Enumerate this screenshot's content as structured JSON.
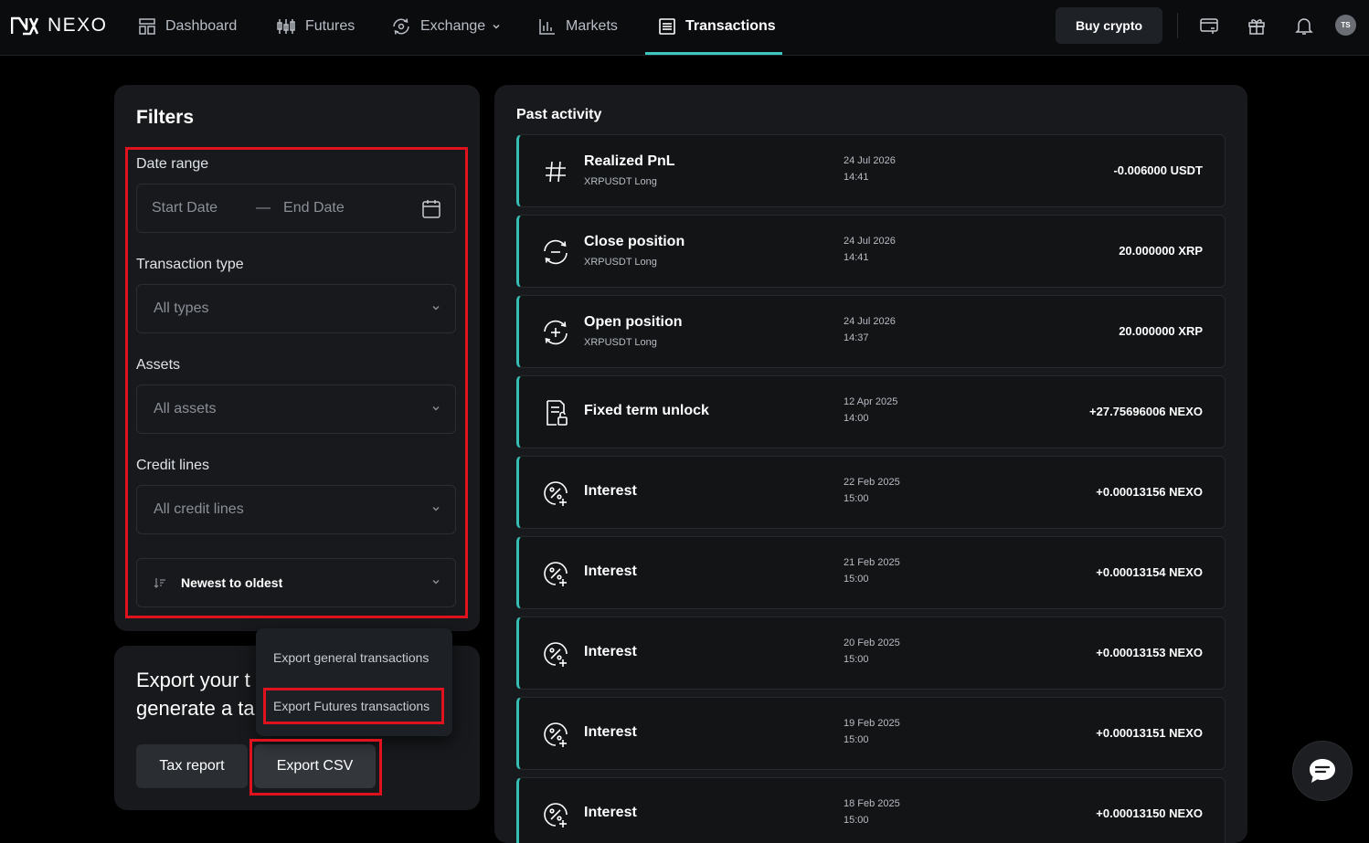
{
  "brand": {
    "name": "NEXO"
  },
  "nav": {
    "dashboard": "Dashboard",
    "futures": "Futures",
    "exchange": "Exchange",
    "markets": "Markets",
    "transactions": "Transactions"
  },
  "header": {
    "buy_crypto": "Buy crypto",
    "avatar_initials": "TS"
  },
  "filters": {
    "title": "Filters",
    "date_range_label": "Date range",
    "start_date_placeholder": "Start Date",
    "end_date_placeholder": "End Date",
    "transaction_type_label": "Transaction type",
    "transaction_type_value": "All types",
    "assets_label": "Assets",
    "assets_value": "All assets",
    "credit_lines_label": "Credit lines",
    "credit_lines_value": "All credit lines",
    "sort_value": "Newest to oldest"
  },
  "export": {
    "text_line1": "Export your t",
    "text_line2": "generate a ta",
    "tax_report": "Tax report",
    "export_csv": "Export CSV",
    "menu_general": "Export general transactions",
    "menu_futures": "Export Futures transactions"
  },
  "activity": {
    "title": "Past activity",
    "rows": [
      {
        "icon": "hash-icon",
        "title": "Realized PnL",
        "subtitle": "XRPUSDT Long",
        "date": "24 Jul 2026",
        "time": "14:41",
        "amount": "-0.006000 USDT"
      },
      {
        "icon": "close-position-icon",
        "title": "Close position",
        "subtitle": "XRPUSDT Long",
        "date": "24 Jul 2026",
        "time": "14:41",
        "amount": "20.000000 XRP"
      },
      {
        "icon": "open-position-icon",
        "title": "Open position",
        "subtitle": "XRPUSDT Long",
        "date": "24 Jul 2026",
        "time": "14:37",
        "amount": "20.000000 XRP"
      },
      {
        "icon": "fixed-term-unlock-icon",
        "title": "Fixed term unlock",
        "subtitle": "",
        "date": "12 Apr 2025",
        "time": "14:00",
        "amount": "+27.75696006 NEXO"
      },
      {
        "icon": "interest-icon",
        "title": "Interest",
        "subtitle": "",
        "date": "22 Feb 2025",
        "time": "15:00",
        "amount": "+0.00013156 NEXO"
      },
      {
        "icon": "interest-icon",
        "title": "Interest",
        "subtitle": "",
        "date": "21 Feb 2025",
        "time": "15:00",
        "amount": "+0.00013154 NEXO"
      },
      {
        "icon": "interest-icon",
        "title": "Interest",
        "subtitle": "",
        "date": "20 Feb 2025",
        "time": "15:00",
        "amount": "+0.00013153 NEXO"
      },
      {
        "icon": "interest-icon",
        "title": "Interest",
        "subtitle": "",
        "date": "19 Feb 2025",
        "time": "15:00",
        "amount": "+0.00013151 NEXO"
      },
      {
        "icon": "interest-icon",
        "title": "Interest",
        "subtitle": "",
        "date": "18 Feb 2025",
        "time": "15:00",
        "amount": "+0.00013150 NEXO"
      }
    ]
  },
  "colors": {
    "accent": "#3ec7c0",
    "highlight": "#e0121e",
    "card": "#17191c"
  }
}
